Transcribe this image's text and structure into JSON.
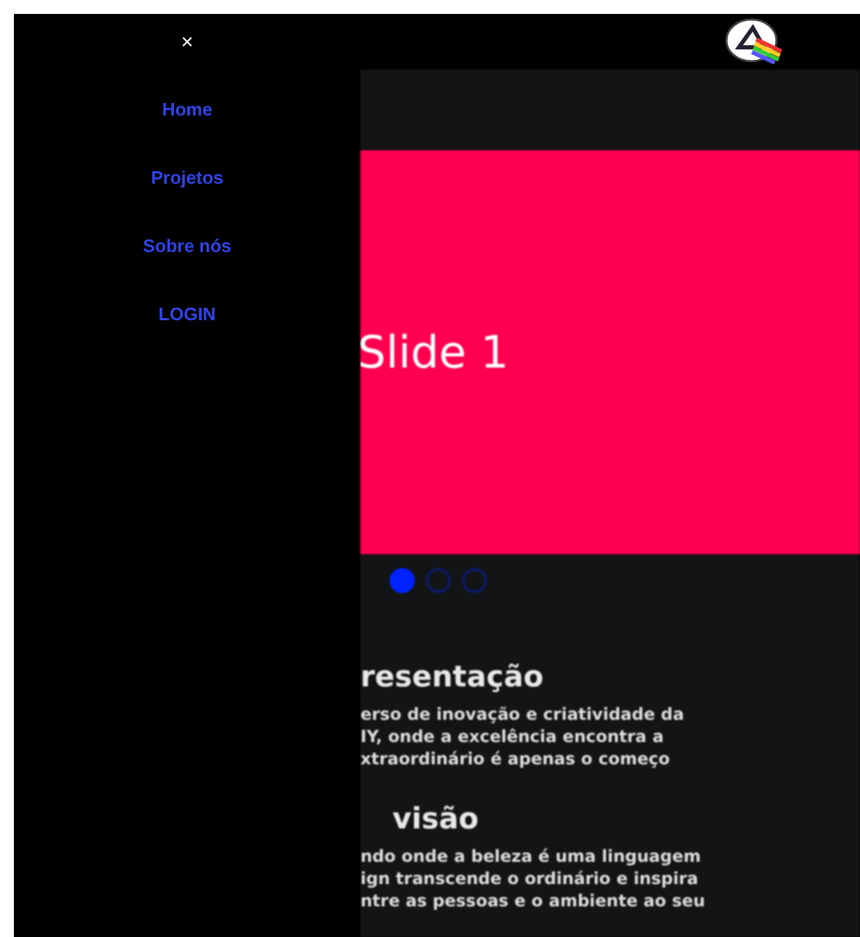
{
  "sidebar": {
    "close": "×",
    "items": [
      {
        "label": "Home"
      },
      {
        "label": "Projetos"
      },
      {
        "label": "Sobre nós"
      },
      {
        "label": "LOGIN"
      }
    ]
  },
  "carousel": {
    "slide_text": "Slide 1",
    "dots": [
      {
        "selected": true
      },
      {
        "selected": false
      },
      {
        "selected": false
      }
    ]
  },
  "sections": [
    {
      "heading": "resentação",
      "indent": false,
      "lines": [
        "erso de inovação e criatividade da",
        "IY, onde a excelência encontra a",
        "xtraordinário é apenas o começo"
      ]
    },
    {
      "heading": "visão",
      "indent": true,
      "lines": [
        "ndo onde a beleza é uma linguagem",
        "ign transcende o ordinário e inspira",
        "ntre as pessoas e o ambiente ao seu"
      ]
    }
  ]
}
